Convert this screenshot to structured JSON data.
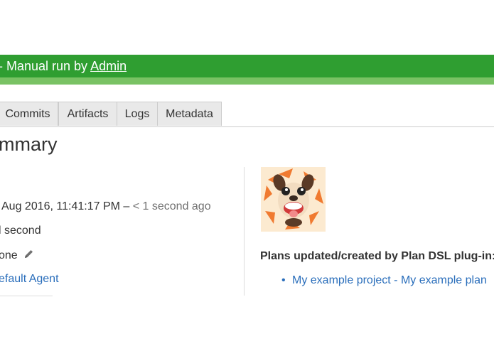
{
  "banner": {
    "text_prefix": "- Manual run by ",
    "user_link": "Admin",
    "color": "#2f9e31",
    "stripe_color": "#79c264"
  },
  "tabs": [
    {
      "label": "Commits"
    },
    {
      "label": "Artifacts"
    },
    {
      "label": "Logs"
    },
    {
      "label": "Metadata"
    }
  ],
  "summary": {
    "heading": "mmary",
    "completed": "Aug 2016, 11:41:17 PM – ",
    "completed_ago": "< 1 second ago",
    "duration": "l second",
    "labels_value": "one",
    "labels_icon": "pencil-icon",
    "agent": "efault Agent"
  },
  "plan_dsl": {
    "heading": "Plans updated/created by Plan DSL plug-in:",
    "plans": [
      {
        "label": "My example project - My example plan"
      }
    ],
    "logo_icon": "dog-avatar-icon"
  },
  "colors": {
    "link": "#2a6ebb",
    "muted": "#707070"
  }
}
